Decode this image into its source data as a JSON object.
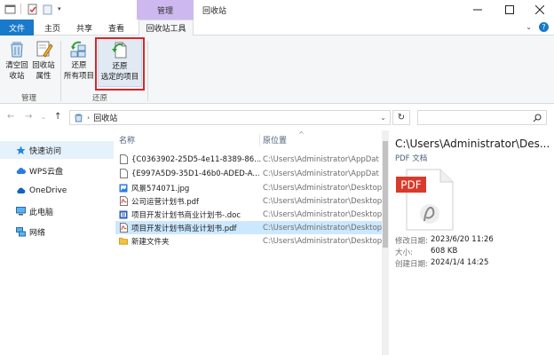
{
  "window": {
    "context_group": "管理",
    "title": "回收站"
  },
  "tabs": {
    "file": "文件",
    "home": "主页",
    "share": "共享",
    "view": "查看",
    "tools": "回收站工具"
  },
  "ribbon": {
    "empty_recycle": [
      "清空回",
      "收站"
    ],
    "properties": [
      "回收站",
      "属性"
    ],
    "group_manage": "管理",
    "restore_all": [
      "还原",
      "所有项目"
    ],
    "restore_selected": [
      "还原",
      "选定的项目"
    ],
    "group_restore": "还原"
  },
  "address": {
    "path": "回收站",
    "search_placeholder": ""
  },
  "nav": {
    "items": [
      {
        "label": "快速访问",
        "icon": "star-icon"
      },
      {
        "label": "WPS云盘",
        "icon": "cloud-icon"
      },
      {
        "label": "OneDrive",
        "icon": "cloud-icon"
      },
      {
        "label": "此电脑",
        "icon": "computer-icon"
      },
      {
        "label": "网络",
        "icon": "network-icon"
      }
    ]
  },
  "list": {
    "col_name": "名称",
    "col_location": "原位置",
    "rows": [
      {
        "name": "{C0363902-25D5-4e11-8389-86...",
        "location": "C:\\Users\\Administrator\\AppDat",
        "icon": "file-icon"
      },
      {
        "name": "{E997A5D9-35D1-46b0-ADED-A...",
        "location": "C:\\Users\\Administrator\\AppDat",
        "icon": "file-icon"
      },
      {
        "name": "风景574071.jpg",
        "location": "C:\\Users\\Administrator\\Desktop",
        "icon": "image-file-icon"
      },
      {
        "name": "公司运营计划书.pdf",
        "location": "C:\\Users\\Administrator\\Desktop",
        "icon": "pdf-file-icon"
      },
      {
        "name": "项目开发计划书商业计划书-.doc",
        "location": "C:\\Users\\Administrator\\Desktop",
        "icon": "word-file-icon"
      },
      {
        "name": "项目开发计划书商业计划书.pdf",
        "location": "C:\\Users\\Administrator\\Desktop",
        "icon": "pdf-file-icon",
        "selected": true
      },
      {
        "name": "新建文件夹",
        "location": "C:\\Users\\Administrator\\Desktop",
        "icon": "folder-icon"
      }
    ]
  },
  "preview": {
    "title": "C:\\Users\\Administrator\\Des...",
    "type": "PDF 文档",
    "badge": "PDF",
    "props": [
      {
        "k": "修改日期:",
        "v": "2023/6/20 11:26"
      },
      {
        "k": "大小:",
        "v": "608 KB"
      },
      {
        "k": "创建日期:",
        "v": "2024/1/4 14:25"
      }
    ]
  },
  "colors": {
    "file_tab": "#1979ca",
    "context_group": "#cdb9ef",
    "selected_row": "#cce8ff",
    "highlight_border": "#d8262b",
    "pdf_red": "#d83b2b"
  }
}
